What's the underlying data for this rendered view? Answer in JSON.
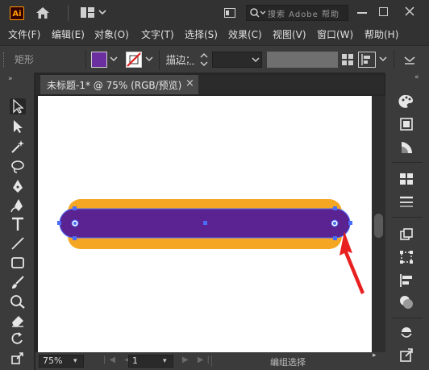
{
  "app": {
    "logo_text": "Ai",
    "search_placeholder": "搜索 Adobe 帮助"
  },
  "menu": {
    "items": [
      "文件(F)",
      "编辑(E)",
      "对象(O)",
      "文字(T)",
      "选择(S)",
      "效果(C)",
      "视图(V)",
      "窗口(W)",
      "帮助(H)"
    ]
  },
  "control_bar": {
    "object_label": "矩形",
    "stroke_label": "描边：",
    "fill_color": "#6b2fa0",
    "stroke_color": "none"
  },
  "document": {
    "tab_title": "未标题-1* @ 75% (RGB/预览)",
    "tab_close": "×"
  },
  "shape": {
    "fill_color": "#5b2392",
    "stroke_color": "#f5a623",
    "selection_color": "#4a6cf7"
  },
  "annotation": {
    "arrow_color": "#e82020"
  },
  "status_bar": {
    "zoom": "75%",
    "artboard": "1",
    "status_text": "编组选择"
  },
  "colors": {
    "ui_dark": "#323232",
    "panel": "#3b3b3b",
    "canvas": "#ffffff"
  }
}
